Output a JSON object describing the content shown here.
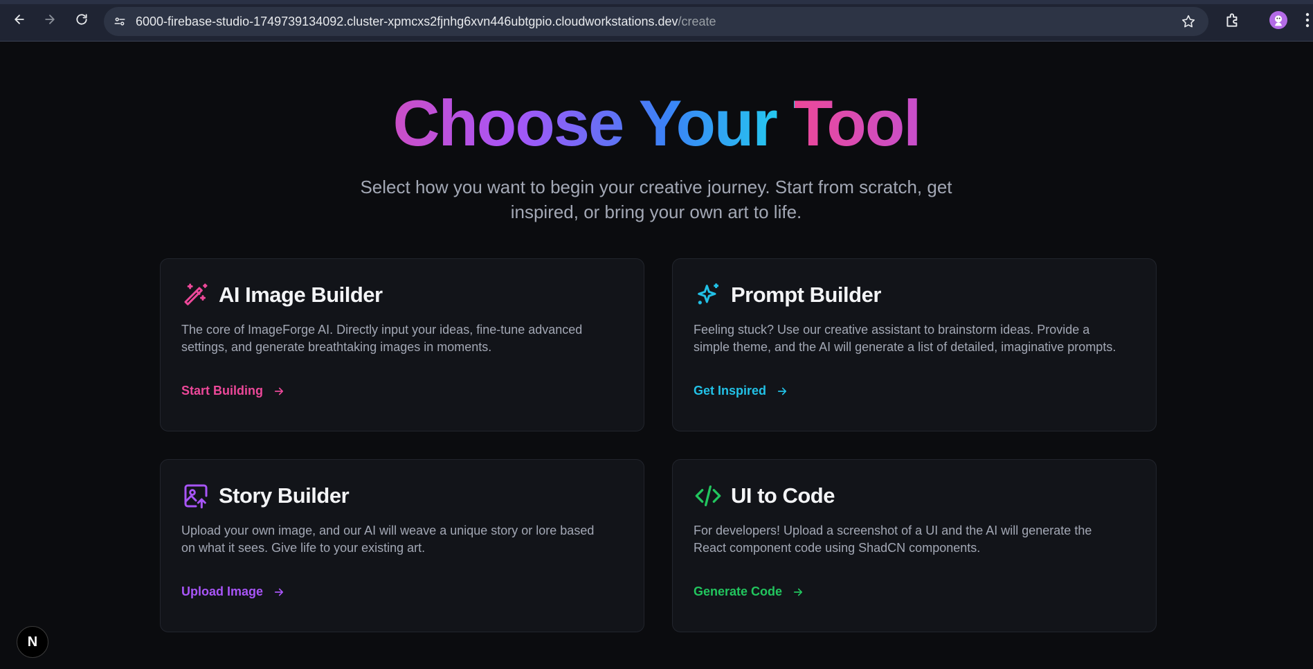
{
  "browser": {
    "url_host": "6000-firebase-studio-1749739134092.cluster-xpmcxs2fjnhg6xvn446ubtgpio.cloudworkstations.dev",
    "url_path": "/create"
  },
  "hero": {
    "title": "Choose Your Tool",
    "subtitle_line1": "Select how you want to begin your creative journey. Start from scratch, get",
    "subtitle_line2": "inspired, or bring your own art to life."
  },
  "cards": [
    {
      "title": "AI Image Builder",
      "description_line1": "The core of ImageForge AI. Directly input your ideas, fine-tune advanced",
      "description_line2": "settings, and generate breathtaking images in moments.",
      "link": "Start Building",
      "icon": "magic-wand-icon",
      "color": "#ec4899"
    },
    {
      "title": "Prompt Builder",
      "description_line1": "Feeling stuck? Use our creative assistant to brainstorm ideas. Provide a",
      "description_line2": "simple theme, and the AI will generate a list of detailed, imaginative prompts.",
      "link": "Get Inspired",
      "icon": "sparkles-icon",
      "color": "#22c1e6"
    },
    {
      "title": "Story Builder",
      "description_line1": "Upload your own image, and our AI will weave a unique story or lore based",
      "description_line2": "on what it sees. Give life to your existing art.",
      "link": "Upload Image",
      "icon": "image-upload-icon",
      "color": "#a855f7"
    },
    {
      "title": "UI to Code",
      "description_line1": "For developers! Upload a screenshot of a UI and the AI will generate the",
      "description_line2": "React component code using ShadCN components.",
      "link": "Generate Code",
      "icon": "code-icon",
      "color": "#22c55e"
    }
  ],
  "dev_badge": {
    "label": "N"
  }
}
